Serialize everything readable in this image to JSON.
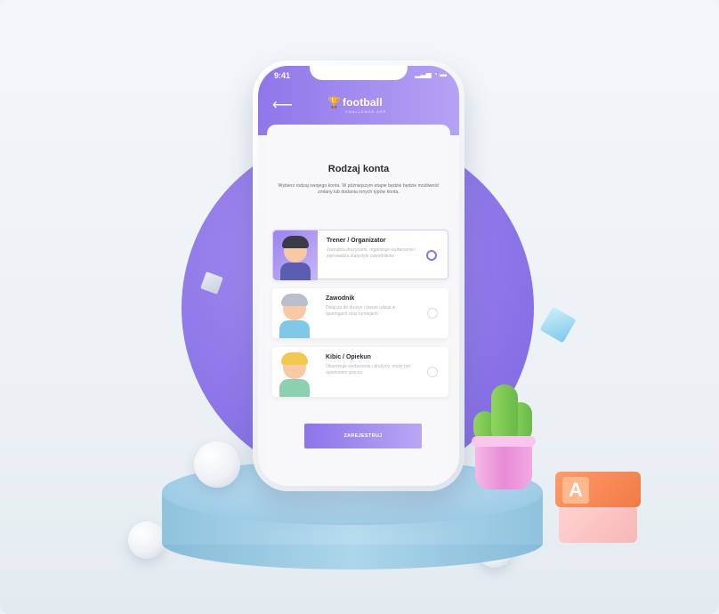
{
  "app": {
    "time": "9:41",
    "status_icons": "▂▃▅ ◔ ▬",
    "logo_text": "football",
    "logo_subtext": "CHALLENGE APP"
  },
  "screen": {
    "title": "Rodzaj konta",
    "subtitle": "Wybierz rodzaj swojego konta. W późniejszym etapie będzie będzie możliwość zmiany lub dodania innych typów konta."
  },
  "options": [
    {
      "name": "Trener / Organizator",
      "desc": "Zarządza drużynami, organizuje wydarzenia i wprowadza statystyki zawodników",
      "selected": true
    },
    {
      "name": "Zawodnik",
      "desc": "Dołącza do drużyn i bierze udział w sparingach oraz turniejach",
      "selected": false
    },
    {
      "name": "Kibic / Opiekun",
      "desc": "Obserwuje wydarzenia i drużyny, może być opiekunem gracza",
      "selected": false
    }
  ],
  "register_label": "ZAREJESTRUJ",
  "decor": {
    "block_letter": "A"
  },
  "colors": {
    "accent": "#8d74ea",
    "accent_light": "#b9a7f4",
    "circle": "#8c75e8"
  }
}
